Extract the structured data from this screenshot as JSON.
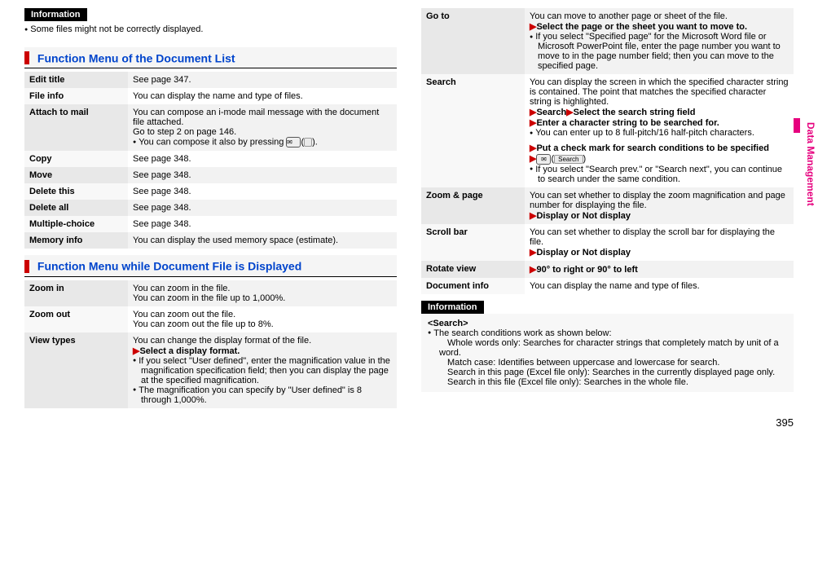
{
  "labels": {
    "information": "Information"
  },
  "left": {
    "info1": "Some files might not be correctly displayed.",
    "menu1_title": "Function Menu of the Document List",
    "menu1": [
      {
        "name": "Edit title",
        "desc": "See page 347."
      },
      {
        "name": "File info",
        "desc": "You can display the name and type of files."
      },
      {
        "name": "Attach to mail",
        "desc_lines": [
          "You can compose an i-mode mail message with the document file attached.",
          "Go to step 2 on page 146."
        ],
        "bullet_with_icons": true
      },
      {
        "name": "Copy",
        "desc": "See page 348."
      },
      {
        "name": "Move",
        "desc": "See page 348."
      },
      {
        "name": "Delete this",
        "desc": "See page 348."
      },
      {
        "name": "Delete all",
        "desc": "See page 348."
      },
      {
        "name": "Multiple-choice",
        "desc": "See page 348."
      },
      {
        "name": "Memory info",
        "desc": "You can display the used memory space (estimate)."
      }
    ],
    "compose_prefix": "You can compose it also by pressing ",
    "menu2_title": "Function Menu while Document File is Displayed",
    "menu2": {
      "zoom_in": {
        "name": "Zoom in",
        "l1": "You can zoom in the file.",
        "l2": "You can zoom in the file up to 1,000%."
      },
      "zoom_out": {
        "name": "Zoom out",
        "l1": "You can zoom out the file.",
        "l2": "You can zoom out the file up to 8%."
      },
      "view_types": {
        "name": "View types",
        "l1": "You can change the display format of the file.",
        "sel": "Select a display format.",
        "b1": "If you select \"User defined\", enter the magnification value in the magnification specification field; then you can display the page at the specified magnification.",
        "b2": "The magnification you can specify by \"User defined\" is 8 through 1,000%."
      }
    }
  },
  "right": {
    "menu3": {
      "goto": {
        "name": "Go to",
        "l1": "You can move to another page or sheet of the file.",
        "sel": "Select the page or the sheet you want to move to.",
        "b1": "If you select \"Specified page\" for the Microsoft Word file or Microsoft PowerPoint file, enter the page number you want to move to in the page number field; then you can move to the specified page."
      },
      "search": {
        "name": "Search",
        "l1": "You can display the screen in which the specified character string is contained. The point that matches the specified character string is highlighted.",
        "sel1a": "Search",
        "sel1b": "Select the search string field",
        "sel2": "Enter a character string to be searched for.",
        "b1": "You can enter up to 8 full-pitch/16 half-pitch characters.",
        "sel3": "Put a check mark for search conditions to be specified",
        "iconlabel": "Search",
        "b2": "If you select \"Search prev.\" or \"Search next\", you can continue to search under the same condition."
      },
      "zoompage": {
        "name": "Zoom & page",
        "l1": "You can set whether to display the zoom magnification and page number for displaying the file.",
        "sel": "Display or Not display"
      },
      "scrollbar": {
        "name": "Scroll bar",
        "l1": "You can set whether to display the scroll bar for displaying the file.",
        "sel": "Display or Not display"
      },
      "rotate": {
        "name": "Rotate view",
        "sel": "90° to right or 90° to left"
      },
      "docinfo": {
        "name": "Document info",
        "l1": "You can display the name and type of files."
      }
    },
    "info2": {
      "heading": "<Search>",
      "l1": "The search conditions work as shown below:",
      "w1": "Whole words only: Searches for character strings that completely match by unit of a word.",
      "w2": "Match case: Identifies between uppercase and lowercase for search.",
      "w3": "Search in this page (Excel file only): Searches in the currently displayed page only.",
      "w4": "Search in this file (Excel file only): Searches in the whole file."
    },
    "side_tab": "Data Management"
  },
  "page_number": "395"
}
